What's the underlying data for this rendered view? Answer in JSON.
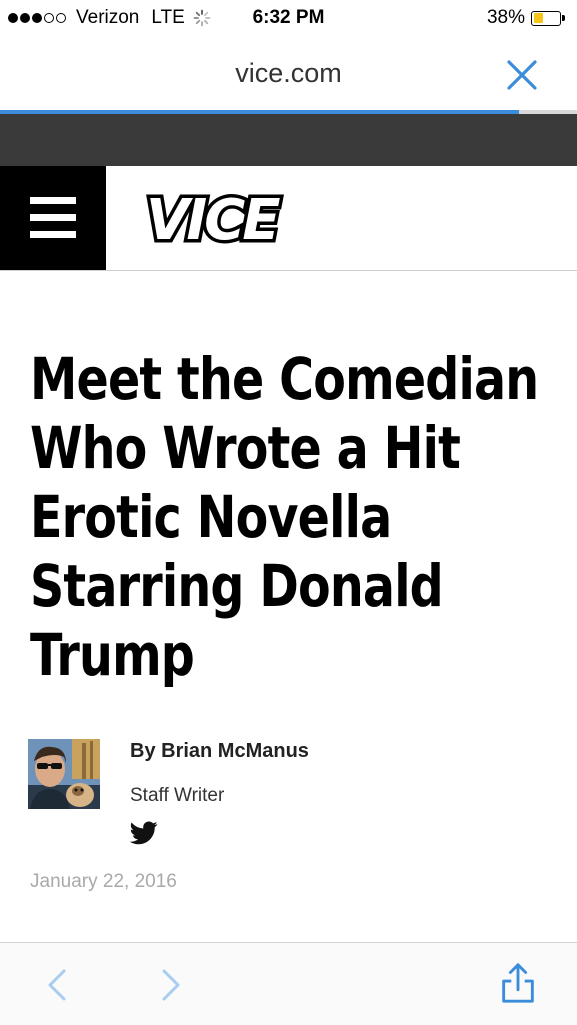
{
  "status_bar": {
    "carrier": "Verizon",
    "network": "LTE",
    "time": "6:32 PM",
    "battery_percent": "38%",
    "battery_level": 0.38,
    "signal_bars_filled": 3,
    "signal_bars_total": 5
  },
  "url_bar": {
    "domain": "vice.com",
    "load_progress": 0.9
  },
  "site_header": {
    "logo_text": "VICE"
  },
  "article": {
    "headline": "Meet the Comedian Who Wrote a Hit Erotic Novella Starring Donald Trump",
    "byline": "By Brian McManus",
    "role": "Staff Writer",
    "date": "January 22, 2016"
  },
  "icons": {
    "close": "close-icon",
    "menu": "hamburger-menu-icon",
    "twitter": "twitter-icon",
    "back": "chevron-left-icon",
    "forward": "chevron-right-icon",
    "share": "share-icon"
  },
  "colors": {
    "accent": "#3b8ddb",
    "battery": "#f5c518",
    "dark_band": "#3a3a3a",
    "date_text": "#a9a9a9"
  }
}
